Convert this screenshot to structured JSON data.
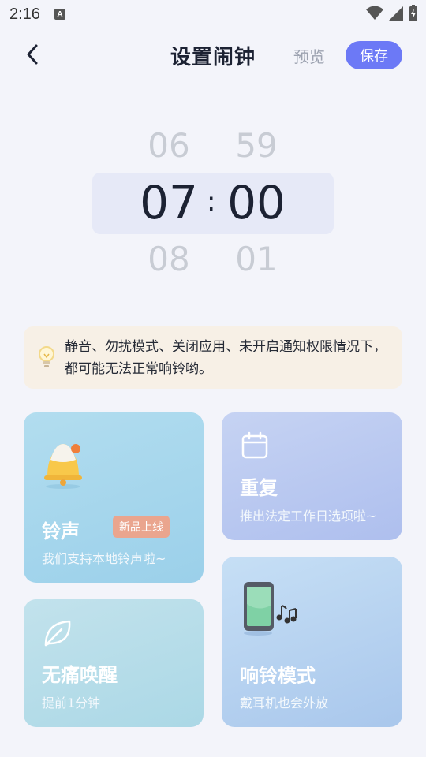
{
  "status_bar": {
    "time": "2:16",
    "notification_letter": "A"
  },
  "header": {
    "title": "设置闹钟",
    "preview_label": "预览",
    "save_label": "保存"
  },
  "time_picker": {
    "hour_prev": "06",
    "hour": "07",
    "hour_next": "08",
    "minute_prev": "59",
    "minute": "00",
    "minute_next": "01",
    "separator": ":"
  },
  "notice": {
    "text": "静音、勿扰模式、关闭应用、未开启通知权限情况下，都可能无法正常响铃哟。"
  },
  "cards": {
    "ringtone": {
      "title": "铃声",
      "badge": "新品上线",
      "subtitle": "我们支持本地铃声啦~"
    },
    "repeat": {
      "title": "重复",
      "subtitle": "推出法定工作日选项啦~"
    },
    "gentle_wake": {
      "title": "无痛唤醒",
      "subtitle": "提前1分钟"
    },
    "ring_mode": {
      "title": "响铃模式",
      "subtitle": "戴耳机也会外放"
    }
  },
  "colors": {
    "accent": "#6c79f6",
    "badge": "#eaa58e",
    "notice_bg": "#f7f0e6"
  }
}
